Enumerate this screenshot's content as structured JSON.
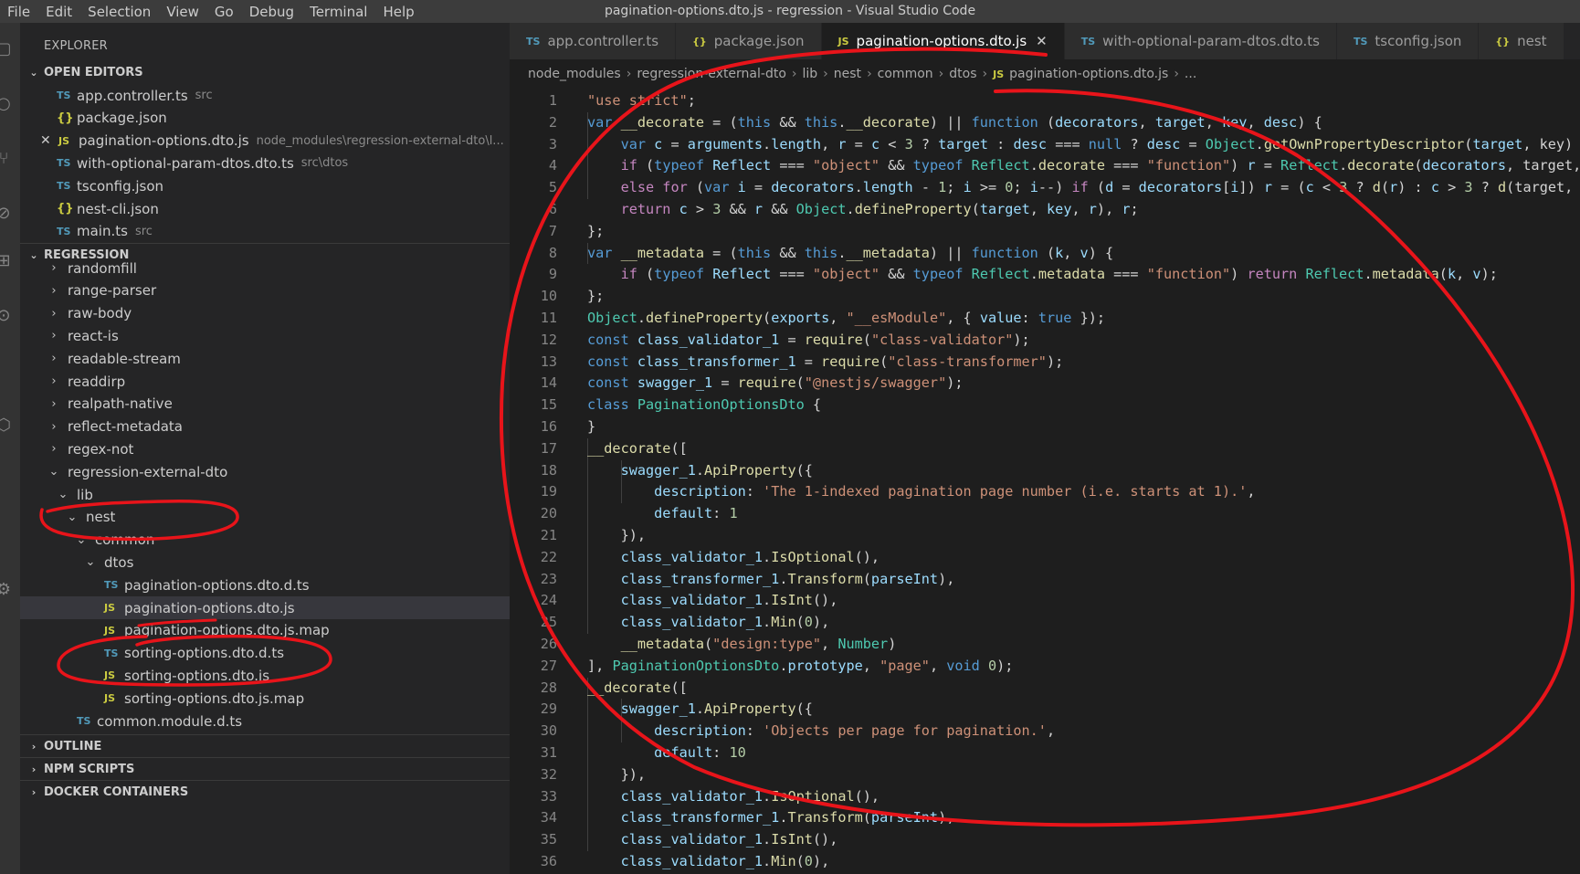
{
  "window": {
    "title": "pagination-options.dto.js - regression - Visual Studio Code"
  },
  "menu": [
    "File",
    "Edit",
    "Selection",
    "View",
    "Go",
    "Debug",
    "Terminal",
    "Help"
  ],
  "activity_bar": [
    "files-icon",
    "search-icon",
    "source-control-icon",
    "debug-icon",
    "extensions-icon",
    "remote-icon",
    "docker-icon",
    "settings-icon"
  ],
  "sidebar": {
    "title": "EXPLORER",
    "open_editors": {
      "header": "OPEN EDITORS",
      "items": [
        {
          "icon": "TS",
          "name": "app.controller.ts",
          "desc": "src"
        },
        {
          "icon": "{}",
          "name": "package.json",
          "desc": ""
        },
        {
          "icon": "JS",
          "name": "pagination-options.dto.js",
          "desc": "node_modules\\regression-external-dto\\l..."
        },
        {
          "icon": "TS",
          "name": "with-optional-param-dtos.dto.ts",
          "desc": "src\\dtos"
        },
        {
          "icon": "TS",
          "name": "tsconfig.json",
          "desc": ""
        },
        {
          "icon": "{}",
          "name": "nest-cli.json",
          "desc": ""
        },
        {
          "icon": "TS",
          "name": "main.ts",
          "desc": "src"
        }
      ]
    },
    "regression": {
      "header": "REGRESSION",
      "items": [
        {
          "name": "randomfill",
          "chev": ">",
          "icon": ""
        },
        {
          "name": "range-parser",
          "chev": ">",
          "icon": ""
        },
        {
          "name": "raw-body",
          "chev": ">",
          "icon": ""
        },
        {
          "name": "react-is",
          "chev": ">",
          "icon": ""
        },
        {
          "name": "readable-stream",
          "chev": ">",
          "icon": ""
        },
        {
          "name": "readdirp",
          "chev": ">",
          "icon": ""
        },
        {
          "name": "realpath-native",
          "chev": ">",
          "icon": ""
        },
        {
          "name": "reflect-metadata",
          "chev": ">",
          "icon": ""
        },
        {
          "name": "regex-not",
          "chev": ">",
          "icon": ""
        },
        {
          "name": "regression-external-dto",
          "chev": "v",
          "icon": ""
        },
        {
          "name": "lib",
          "chev": "v",
          "icon": ""
        },
        {
          "name": "nest",
          "chev": "v",
          "icon": ""
        },
        {
          "name": "common",
          "chev": "v",
          "icon": ""
        },
        {
          "name": "dtos",
          "chev": "v",
          "icon": ""
        },
        {
          "name": "pagination-options.dto.d.ts",
          "chev": "",
          "icon": "TS"
        },
        {
          "name": "pagination-options.dto.js",
          "chev": "",
          "icon": "JS"
        },
        {
          "name": "pagination-options.dto.js.map",
          "chev": "",
          "icon": "JS"
        },
        {
          "name": "sorting-options.dto.d.ts",
          "chev": "",
          "icon": "TS"
        },
        {
          "name": "sorting-options.dto.js",
          "chev": "",
          "icon": "JS"
        },
        {
          "name": "sorting-options.dto.js.map",
          "chev": "",
          "icon": "JS"
        },
        {
          "name": "common.module.d.ts",
          "chev": "",
          "icon": "TS"
        }
      ]
    },
    "outline": "OUTLINE",
    "npm_scripts": "NPM SCRIPTS",
    "docker_containers": "DOCKER CONTAINERS"
  },
  "tabs": [
    {
      "icon": "TS",
      "label": "app.controller.ts"
    },
    {
      "icon": "{}",
      "label": "package.json"
    },
    {
      "icon": "JS",
      "label": "pagination-options.dto.js"
    },
    {
      "icon": "TS",
      "label": "with-optional-param-dtos.dto.ts"
    },
    {
      "icon": "TS",
      "label": "tsconfig.json"
    },
    {
      "icon": "{}",
      "label": "nest"
    }
  ],
  "breadcrumb": [
    "node_modules",
    "regression-external-dto",
    "lib",
    "nest",
    "common",
    "dtos",
    "pagination-options.dto.js",
    "..."
  ],
  "code": [
    [
      [
        "str",
        "\"use strict\""
      ],
      [
        "pn",
        ";"
      ]
    ],
    [
      [
        "kw",
        "var "
      ],
      [
        "fn",
        "__decorate"
      ],
      [
        "pn",
        " = ("
      ],
      [
        "kw",
        "this"
      ],
      [
        "pn",
        " && "
      ],
      [
        "kw",
        "this"
      ],
      [
        "pn",
        "."
      ],
      [
        "fn",
        "__decorate"
      ],
      [
        "pn",
        ") || "
      ],
      [
        "kw",
        "function"
      ],
      [
        "pn",
        " ("
      ],
      [
        "var",
        "decorators"
      ],
      [
        "pn",
        ", "
      ],
      [
        "var",
        "target"
      ],
      [
        "pn",
        ", "
      ],
      [
        "var",
        "key"
      ],
      [
        "pn",
        ", "
      ],
      [
        "var",
        "desc"
      ],
      [
        "pn",
        ") {"
      ]
    ],
    [
      [
        "pn",
        "    "
      ],
      [
        "kw",
        "var "
      ],
      [
        "var",
        "c"
      ],
      [
        "pn",
        " = "
      ],
      [
        "var",
        "arguments"
      ],
      [
        "pn",
        "."
      ],
      [
        "var",
        "length"
      ],
      [
        "pn",
        ", "
      ],
      [
        "var",
        "r"
      ],
      [
        "pn",
        " = "
      ],
      [
        "var",
        "c"
      ],
      [
        "pn",
        " < "
      ],
      [
        "num",
        "3"
      ],
      [
        "pn",
        " ? "
      ],
      [
        "var",
        "target"
      ],
      [
        "pn",
        " : "
      ],
      [
        "var",
        "desc"
      ],
      [
        "pn",
        " === "
      ],
      [
        "kw",
        "null"
      ],
      [
        "pn",
        " ? "
      ],
      [
        "var",
        "desc"
      ],
      [
        "pn",
        " = "
      ],
      [
        "cls",
        "Object"
      ],
      [
        "pn",
        "."
      ],
      [
        "fn",
        "getOwnPropertyDescriptor"
      ],
      [
        "pn",
        "("
      ],
      [
        "var",
        "target"
      ],
      [
        "pn",
        ", key) : desc, d;"
      ]
    ],
    [
      [
        "pn",
        "    "
      ],
      [
        "ctl",
        "if"
      ],
      [
        "pn",
        " ("
      ],
      [
        "kw",
        "typeof "
      ],
      [
        "var",
        "Reflect"
      ],
      [
        "pn",
        " === "
      ],
      [
        "str",
        "\"object\""
      ],
      [
        "pn",
        " && "
      ],
      [
        "kw",
        "typeof "
      ],
      [
        "cls",
        "Reflect"
      ],
      [
        "pn",
        "."
      ],
      [
        "fn",
        "decorate"
      ],
      [
        "pn",
        " === "
      ],
      [
        "str",
        "\"function\""
      ],
      [
        "pn",
        ") "
      ],
      [
        "var",
        "r"
      ],
      [
        "pn",
        " = "
      ],
      [
        "cls",
        "Reflect"
      ],
      [
        "pn",
        "."
      ],
      [
        "fn",
        "decorate"
      ],
      [
        "pn",
        "("
      ],
      [
        "var",
        "decorators"
      ],
      [
        "pn",
        ", target, key, desc);"
      ]
    ],
    [
      [
        "pn",
        "    "
      ],
      [
        "ctl",
        "else for"
      ],
      [
        "pn",
        " ("
      ],
      [
        "kw",
        "var "
      ],
      [
        "var",
        "i"
      ],
      [
        "pn",
        " = "
      ],
      [
        "var",
        "decorators"
      ],
      [
        "pn",
        "."
      ],
      [
        "var",
        "length"
      ],
      [
        "pn",
        " - "
      ],
      [
        "num",
        "1"
      ],
      [
        "pn",
        "; "
      ],
      [
        "var",
        "i"
      ],
      [
        "pn",
        " >= "
      ],
      [
        "num",
        "0"
      ],
      [
        "pn",
        "; "
      ],
      [
        "var",
        "i"
      ],
      [
        "pn",
        "--) "
      ],
      [
        "ctl",
        "if"
      ],
      [
        "pn",
        " ("
      ],
      [
        "var",
        "d"
      ],
      [
        "pn",
        " = "
      ],
      [
        "var",
        "decorators"
      ],
      [
        "pn",
        "["
      ],
      [
        "var",
        "i"
      ],
      [
        "pn",
        "]) "
      ],
      [
        "var",
        "r"
      ],
      [
        "pn",
        " = ("
      ],
      [
        "var",
        "c"
      ],
      [
        "pn",
        " < "
      ],
      [
        "num",
        "3"
      ],
      [
        "pn",
        " ? "
      ],
      [
        "fn",
        "d"
      ],
      [
        "pn",
        "("
      ],
      [
        "var",
        "r"
      ],
      [
        "pn",
        ") : "
      ],
      [
        "var",
        "c"
      ],
      [
        "pn",
        " > "
      ],
      [
        "num",
        "3"
      ],
      [
        "pn",
        " ? "
      ],
      [
        "fn",
        "d"
      ],
      [
        "pn",
        "(target, key, r) : d(target, key)) || r;"
      ]
    ],
    [
      [
        "pn",
        "    "
      ],
      [
        "ctl",
        "return "
      ],
      [
        "var",
        "c"
      ],
      [
        "pn",
        " > "
      ],
      [
        "num",
        "3"
      ],
      [
        "pn",
        " && "
      ],
      [
        "var",
        "r"
      ],
      [
        "pn",
        " && "
      ],
      [
        "cls",
        "Object"
      ],
      [
        "pn",
        "."
      ],
      [
        "fn",
        "defineProperty"
      ],
      [
        "pn",
        "("
      ],
      [
        "var",
        "target"
      ],
      [
        "pn",
        ", "
      ],
      [
        "var",
        "key"
      ],
      [
        "pn",
        ", "
      ],
      [
        "var",
        "r"
      ],
      [
        "pn",
        "), "
      ],
      [
        "var",
        "r"
      ],
      [
        "pn",
        ";"
      ]
    ],
    [
      [
        "pn",
        "};"
      ]
    ],
    [
      [
        "kw",
        "var "
      ],
      [
        "fn",
        "__metadata"
      ],
      [
        "pn",
        " = ("
      ],
      [
        "kw",
        "this"
      ],
      [
        "pn",
        " && "
      ],
      [
        "kw",
        "this"
      ],
      [
        "pn",
        "."
      ],
      [
        "fn",
        "__metadata"
      ],
      [
        "pn",
        ") || "
      ],
      [
        "kw",
        "function"
      ],
      [
        "pn",
        " ("
      ],
      [
        "var",
        "k"
      ],
      [
        "pn",
        ", "
      ],
      [
        "var",
        "v"
      ],
      [
        "pn",
        ") {"
      ]
    ],
    [
      [
        "pn",
        "    "
      ],
      [
        "ctl",
        "if"
      ],
      [
        "pn",
        " ("
      ],
      [
        "kw",
        "typeof "
      ],
      [
        "var",
        "Reflect"
      ],
      [
        "pn",
        " === "
      ],
      [
        "str",
        "\"object\""
      ],
      [
        "pn",
        " && "
      ],
      [
        "kw",
        "typeof "
      ],
      [
        "cls",
        "Reflect"
      ],
      [
        "pn",
        "."
      ],
      [
        "fn",
        "metadata"
      ],
      [
        "pn",
        " === "
      ],
      [
        "str",
        "\"function\""
      ],
      [
        "pn",
        ") "
      ],
      [
        "ctl",
        "return "
      ],
      [
        "cls",
        "Reflect"
      ],
      [
        "pn",
        "."
      ],
      [
        "fn",
        "metadata"
      ],
      [
        "pn",
        "("
      ],
      [
        "var",
        "k"
      ],
      [
        "pn",
        ", "
      ],
      [
        "var",
        "v"
      ],
      [
        "pn",
        ");"
      ]
    ],
    [
      [
        "pn",
        "};"
      ]
    ],
    [
      [
        "cls",
        "Object"
      ],
      [
        "pn",
        "."
      ],
      [
        "fn",
        "defineProperty"
      ],
      [
        "pn",
        "("
      ],
      [
        "var",
        "exports"
      ],
      [
        "pn",
        ", "
      ],
      [
        "str",
        "\"__esModule\""
      ],
      [
        "pn",
        ", { "
      ],
      [
        "var",
        "value"
      ],
      [
        "pn",
        ": "
      ],
      [
        "kw",
        "true"
      ],
      [
        "pn",
        " });"
      ]
    ],
    [
      [
        "kw",
        "const "
      ],
      [
        "var",
        "class_validator_1"
      ],
      [
        "pn",
        " = "
      ],
      [
        "fn",
        "require"
      ],
      [
        "pn",
        "("
      ],
      [
        "str",
        "\"class-validator\""
      ],
      [
        "pn",
        ");"
      ]
    ],
    [
      [
        "kw",
        "const "
      ],
      [
        "var",
        "class_transformer_1"
      ],
      [
        "pn",
        " = "
      ],
      [
        "fn",
        "require"
      ],
      [
        "pn",
        "("
      ],
      [
        "str",
        "\"class-transformer\""
      ],
      [
        "pn",
        ");"
      ]
    ],
    [
      [
        "kw",
        "const "
      ],
      [
        "var",
        "swagger_1"
      ],
      [
        "pn",
        " = "
      ],
      [
        "fn",
        "require"
      ],
      [
        "pn",
        "("
      ],
      [
        "str",
        "\"@nestjs/swagger\""
      ],
      [
        "pn",
        ");"
      ]
    ],
    [
      [
        "kw",
        "class "
      ],
      [
        "cls",
        "PaginationOptionsDto"
      ],
      [
        "pn",
        " {"
      ]
    ],
    [
      [
        "pn",
        "}"
      ]
    ],
    [
      [
        "fn",
        "__decorate"
      ],
      [
        "pn",
        "(["
      ]
    ],
    [
      [
        "pn",
        "    "
      ],
      [
        "var",
        "swagger_1"
      ],
      [
        "pn",
        "."
      ],
      [
        "fn",
        "ApiProperty"
      ],
      [
        "pn",
        "({"
      ]
    ],
    [
      [
        "pn",
        "        "
      ],
      [
        "var",
        "description"
      ],
      [
        "pn",
        ": "
      ],
      [
        "str",
        "'The 1-indexed pagination page number (i.e. starts at 1).'"
      ],
      [
        "pn",
        ","
      ]
    ],
    [
      [
        "pn",
        "        "
      ],
      [
        "var",
        "default"
      ],
      [
        "pn",
        ": "
      ],
      [
        "num",
        "1"
      ]
    ],
    [
      [
        "pn",
        "    }),"
      ]
    ],
    [
      [
        "pn",
        "    "
      ],
      [
        "var",
        "class_validator_1"
      ],
      [
        "pn",
        "."
      ],
      [
        "fn",
        "IsOptional"
      ],
      [
        "pn",
        "(),"
      ]
    ],
    [
      [
        "pn",
        "    "
      ],
      [
        "var",
        "class_transformer_1"
      ],
      [
        "pn",
        "."
      ],
      [
        "fn",
        "Transform"
      ],
      [
        "pn",
        "("
      ],
      [
        "var",
        "parseInt"
      ],
      [
        "pn",
        "),"
      ]
    ],
    [
      [
        "pn",
        "    "
      ],
      [
        "var",
        "class_validator_1"
      ],
      [
        "pn",
        "."
      ],
      [
        "fn",
        "IsInt"
      ],
      [
        "pn",
        "(),"
      ]
    ],
    [
      [
        "pn",
        "    "
      ],
      [
        "var",
        "class_validator_1"
      ],
      [
        "pn",
        "."
      ],
      [
        "fn",
        "Min"
      ],
      [
        "pn",
        "("
      ],
      [
        "num",
        "0"
      ],
      [
        "pn",
        "),"
      ]
    ],
    [
      [
        "pn",
        "    "
      ],
      [
        "fn",
        "__metadata"
      ],
      [
        "pn",
        "("
      ],
      [
        "str",
        "\"design:type\""
      ],
      [
        "pn",
        ", "
      ],
      [
        "cls",
        "Number"
      ],
      [
        "pn",
        ")"
      ]
    ],
    [
      [
        "pn",
        "], "
      ],
      [
        "cls",
        "PaginationOptionsDto"
      ],
      [
        "pn",
        "."
      ],
      [
        "var",
        "prototype"
      ],
      [
        "pn",
        ", "
      ],
      [
        "str",
        "\"page\""
      ],
      [
        "pn",
        ", "
      ],
      [
        "kw",
        "void "
      ],
      [
        "num",
        "0"
      ],
      [
        "pn",
        ");"
      ]
    ],
    [
      [
        "fn",
        "__decorate"
      ],
      [
        "pn",
        "(["
      ]
    ],
    [
      [
        "pn",
        "    "
      ],
      [
        "var",
        "swagger_1"
      ],
      [
        "pn",
        "."
      ],
      [
        "fn",
        "ApiProperty"
      ],
      [
        "pn",
        "({"
      ]
    ],
    [
      [
        "pn",
        "        "
      ],
      [
        "var",
        "description"
      ],
      [
        "pn",
        ": "
      ],
      [
        "str",
        "'Objects per page for pagination.'"
      ],
      [
        "pn",
        ","
      ]
    ],
    [
      [
        "pn",
        "        "
      ],
      [
        "var",
        "default"
      ],
      [
        "pn",
        ": "
      ],
      [
        "num",
        "10"
      ]
    ],
    [
      [
        "pn",
        "    }),"
      ]
    ],
    [
      [
        "pn",
        "    "
      ],
      [
        "var",
        "class_validator_1"
      ],
      [
        "pn",
        "."
      ],
      [
        "fn",
        "IsOptional"
      ],
      [
        "pn",
        "(),"
      ]
    ],
    [
      [
        "pn",
        "    "
      ],
      [
        "var",
        "class_transformer_1"
      ],
      [
        "pn",
        "."
      ],
      [
        "fn",
        "Transform"
      ],
      [
        "pn",
        "("
      ],
      [
        "var",
        "parseInt"
      ],
      [
        "pn",
        "),"
      ]
    ],
    [
      [
        "pn",
        "    "
      ],
      [
        "var",
        "class_validator_1"
      ],
      [
        "pn",
        "."
      ],
      [
        "fn",
        "IsInt"
      ],
      [
        "pn",
        "(),"
      ]
    ],
    [
      [
        "pn",
        "    "
      ],
      [
        "var",
        "class_validator_1"
      ],
      [
        "pn",
        "."
      ],
      [
        "fn",
        "Min"
      ],
      [
        "pn",
        "("
      ],
      [
        "num",
        "0"
      ],
      [
        "pn",
        "),"
      ]
    ]
  ],
  "colors": {
    "annotation": "#e8141a",
    "editor_bg": "#1e1e1e",
    "sidebar_bg": "#252526"
  }
}
